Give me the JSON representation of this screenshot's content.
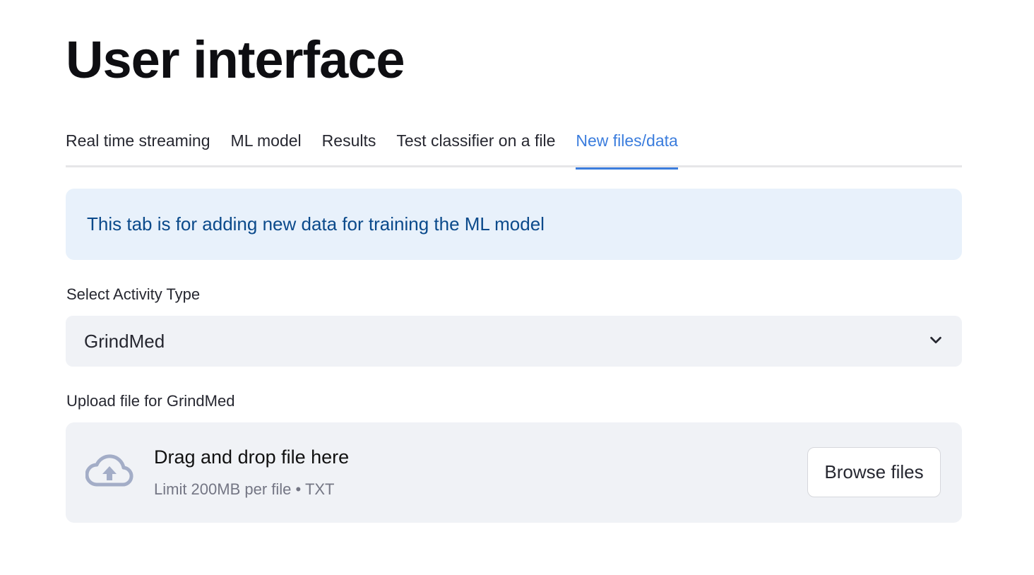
{
  "page": {
    "title": "User interface"
  },
  "tabs": [
    {
      "label": "Real time streaming",
      "active": false
    },
    {
      "label": "ML model",
      "active": false
    },
    {
      "label": "Results",
      "active": false
    },
    {
      "label": "Test classifier on a file",
      "active": false
    },
    {
      "label": "New files/data",
      "active": true
    }
  ],
  "info": {
    "text": "This tab is for adding new data for training the ML model"
  },
  "activity_select": {
    "label": "Select Activity Type",
    "value": "GrindMed",
    "icon": "chevron-down-icon"
  },
  "uploader": {
    "label": "Upload file for GrindMed",
    "drop_text": "Drag and drop file here",
    "limit_text": "Limit 200MB per file • TXT",
    "browse_label": "Browse files",
    "icon": "cloud-upload-icon"
  },
  "colors": {
    "accent": "#3b7ddd",
    "info_bg": "#e8f1fb",
    "info_text": "#0b4a8b",
    "input_bg": "#f0f2f6"
  }
}
